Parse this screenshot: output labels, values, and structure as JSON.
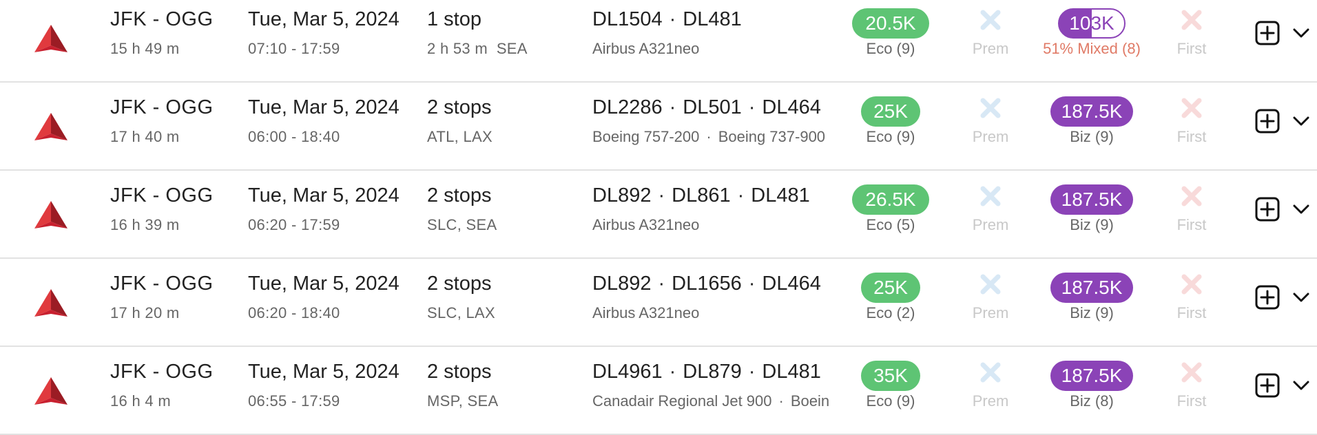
{
  "colors": {
    "eco_pill": "#5ec474",
    "biz_pill": "#8b43b7",
    "prem_x": "#d8e8f5",
    "first_x": "#f8dada",
    "mixed_text": "#e07a66",
    "delta_red": "#c8202f"
  },
  "icons": {
    "airline": "delta-logo-icon",
    "unavailable": "x-icon",
    "add": "plus-square-icon",
    "expand": "chevron-down-icon"
  },
  "results": [
    {
      "route": "JFK - OGG",
      "duration": "15 h 49 m",
      "date": "Tue, Mar 5, 2024",
      "times": "07:10 - 17:59",
      "stops": "1 stop",
      "stops_detail": "2 h 53 m  SEA",
      "flights": [
        "DL1504",
        "DL481"
      ],
      "aircraft": [
        "Airbus A321neo"
      ],
      "eco_price": "20.5K",
      "eco_label": "Eco (9)",
      "prem_label": "Prem",
      "biz_price": "103K",
      "biz_label": "51% Mixed (8)",
      "biz_mixed": true,
      "first_label": "First"
    },
    {
      "route": "JFK - OGG",
      "duration": "17 h 40 m",
      "date": "Tue, Mar 5, 2024",
      "times": "06:00 - 18:40",
      "stops": "2 stops",
      "stops_detail": "ATL, LAX",
      "flights": [
        "DL2286",
        "DL501",
        "DL464"
      ],
      "aircraft": [
        "Boeing 757-200",
        "Boeing 737-900"
      ],
      "eco_price": "25K",
      "eco_label": "Eco (9)",
      "prem_label": "Prem",
      "biz_price": "187.5K",
      "biz_label": "Biz (9)",
      "biz_mixed": false,
      "first_label": "First"
    },
    {
      "route": "JFK - OGG",
      "duration": "16 h 39 m",
      "date": "Tue, Mar 5, 2024",
      "times": "06:20 - 17:59",
      "stops": "2 stops",
      "stops_detail": "SLC, SEA",
      "flights": [
        "DL892",
        "DL861",
        "DL481"
      ],
      "aircraft": [
        "Airbus A321neo"
      ],
      "eco_price": "26.5K",
      "eco_label": "Eco (5)",
      "prem_label": "Prem",
      "biz_price": "187.5K",
      "biz_label": "Biz (9)",
      "biz_mixed": false,
      "first_label": "First"
    },
    {
      "route": "JFK - OGG",
      "duration": "17 h 20 m",
      "date": "Tue, Mar 5, 2024",
      "times": "06:20 - 18:40",
      "stops": "2 stops",
      "stops_detail": "SLC, LAX",
      "flights": [
        "DL892",
        "DL1656",
        "DL464"
      ],
      "aircraft": [
        "Airbus A321neo"
      ],
      "eco_price": "25K",
      "eco_label": "Eco (2)",
      "prem_label": "Prem",
      "biz_price": "187.5K",
      "biz_label": "Biz (9)",
      "biz_mixed": false,
      "first_label": "First"
    },
    {
      "route": "JFK - OGG",
      "duration": "16 h 4 m",
      "date": "Tue, Mar 5, 2024",
      "times": "06:55 - 17:59",
      "stops": "2 stops",
      "stops_detail": "MSP, SEA",
      "flights": [
        "DL4961",
        "DL879",
        "DL481"
      ],
      "aircraft": [
        "Canadair Regional Jet 900",
        "Boein"
      ],
      "eco_price": "35K",
      "eco_label": "Eco (9)",
      "prem_label": "Prem",
      "biz_price": "187.5K",
      "biz_label": "Biz (8)",
      "biz_mixed": false,
      "first_label": "First"
    }
  ]
}
